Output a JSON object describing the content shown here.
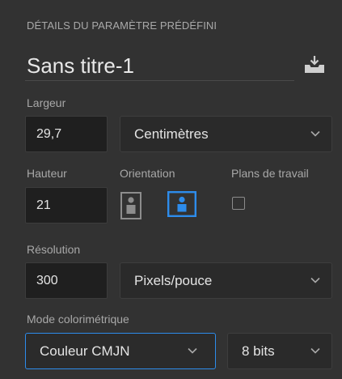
{
  "panel": {
    "title": "DÉTAILS DU PARAMÈTRE PRÉDÉFINI",
    "document_name": "Sans titre-1",
    "save_icon": "save-preset-icon"
  },
  "width": {
    "label": "Largeur",
    "value": "29,7",
    "unit": "Centimètres"
  },
  "height": {
    "label": "Hauteur",
    "value": "21"
  },
  "orientation": {
    "label": "Orientation",
    "selected": "landscape",
    "options": [
      "portrait",
      "landscape"
    ]
  },
  "artboards": {
    "label": "Plans de travail",
    "checked": false
  },
  "resolution": {
    "label": "Résolution",
    "value": "300",
    "unit": "Pixels/pouce"
  },
  "color_mode": {
    "label": "Mode colorimétrique",
    "mode": "Couleur CMJN",
    "depth": "8 bits"
  },
  "colors": {
    "accent": "#2d8ceb",
    "background": "#323232",
    "field": "#1f1f1f"
  }
}
